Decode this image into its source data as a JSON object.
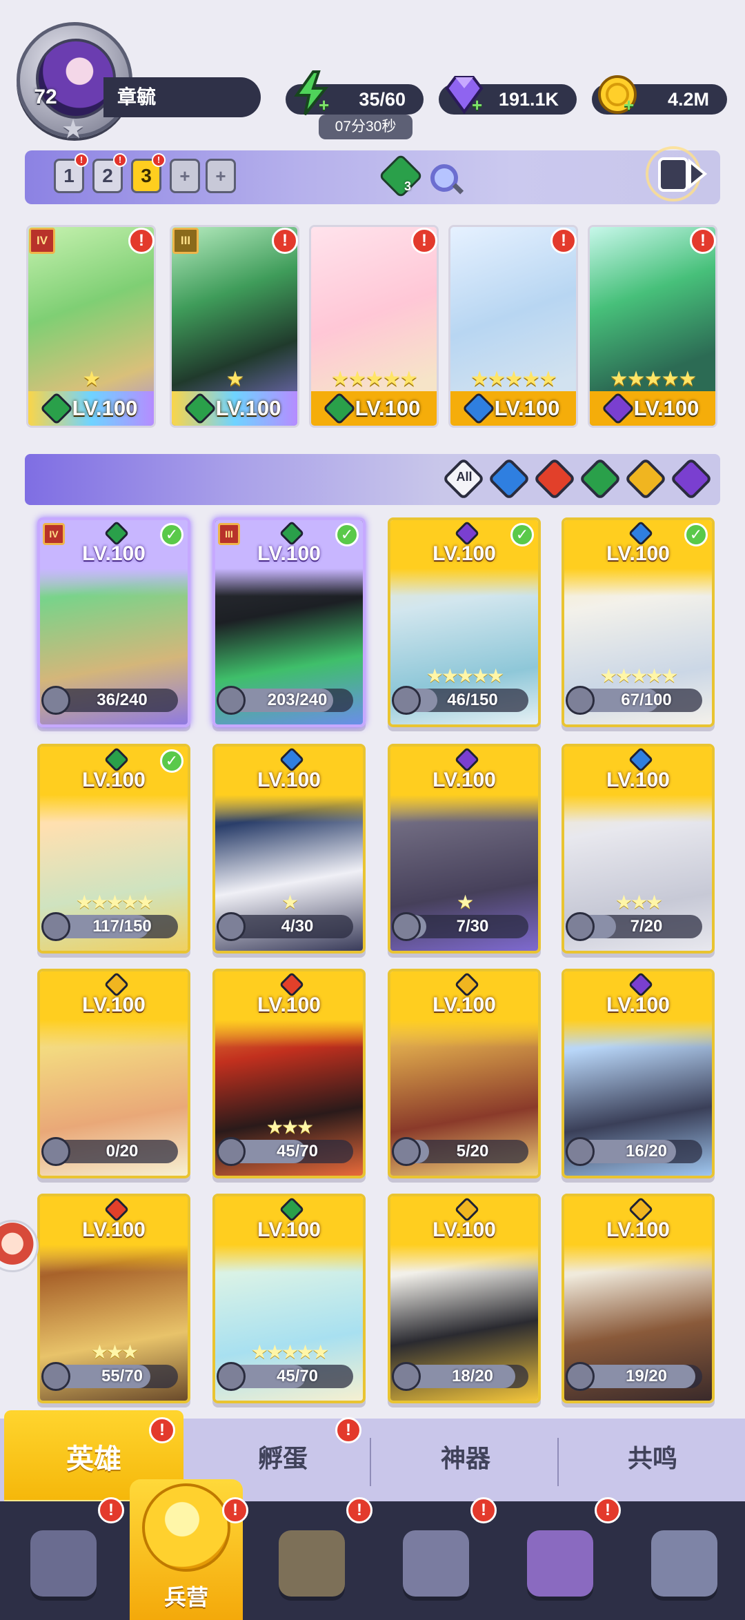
{
  "player": {
    "level": "72",
    "name": "章毓"
  },
  "resources": {
    "energy": "35/60",
    "energy_timer": "07分30秒",
    "gems": "191.1K",
    "gold": "4.2M"
  },
  "teams": {
    "slots": [
      "1",
      "2",
      "3"
    ],
    "active_slot": "3",
    "add_slots": [
      "+",
      "+"
    ],
    "gem_count": "3"
  },
  "lineup": [
    {
      "level": "LV.100",
      "element": "nature",
      "rank": "IV",
      "stars": "★",
      "alert": "!"
    },
    {
      "level": "LV.100",
      "element": "nature",
      "rank": "III",
      "stars": "★",
      "alert": "!"
    },
    {
      "level": "LV.100",
      "element": "nature",
      "rank": "",
      "stars": "★★★★★",
      "alert": "!"
    },
    {
      "level": "LV.100",
      "element": "water",
      "rank": "",
      "stars": "★★★★★",
      "alert": "!"
    },
    {
      "level": "LV.100",
      "element": "dark",
      "rank": "",
      "stars": "★★★★★",
      "alert": "!"
    }
  ],
  "filters": {
    "all_label": "All",
    "elements": [
      "water",
      "fire",
      "nature",
      "light",
      "dark"
    ]
  },
  "heroes": [
    {
      "level": "LV.100",
      "element": "nature",
      "rank": "IV",
      "fragments": "36/240",
      "progress": 0.15,
      "checked": true,
      "style": "purple"
    },
    {
      "level": "LV.100",
      "element": "nature",
      "rank": "III",
      "fragments": "203/240",
      "progress": 0.85,
      "checked": true,
      "style": "purple"
    },
    {
      "level": "LV.100",
      "element": "dark",
      "rank": "",
      "fragments": "46/150",
      "progress": 0.31,
      "checked": true,
      "style": "gold"
    },
    {
      "level": "LV.100",
      "element": "water",
      "rank": "",
      "fragments": "67/100",
      "progress": 0.67,
      "checked": true,
      "style": "gold"
    },
    {
      "level": "LV.100",
      "element": "nature",
      "rank": "",
      "fragments": "117/150",
      "progress": 0.78,
      "checked": true,
      "style": "gold"
    },
    {
      "level": "LV.100",
      "element": "water",
      "rank": "",
      "fragments": "4/30",
      "progress": 0.13,
      "checked": false,
      "style": "gold"
    },
    {
      "level": "LV.100",
      "element": "dark",
      "rank": "",
      "fragments": "7/30",
      "progress": 0.23,
      "checked": false,
      "style": "gold"
    },
    {
      "level": "LV.100",
      "element": "water",
      "rank": "",
      "fragments": "7/20",
      "progress": 0.35,
      "checked": false,
      "style": "gold"
    },
    {
      "level": "LV.100",
      "element": "light",
      "rank": "",
      "fragments": "0/20",
      "progress": 0.0,
      "checked": false,
      "style": "gold"
    },
    {
      "level": "LV.100",
      "element": "fire",
      "rank": "",
      "fragments": "45/70",
      "progress": 0.64,
      "checked": false,
      "style": "gold"
    },
    {
      "level": "LV.100",
      "element": "light",
      "rank": "",
      "fragments": "5/20",
      "progress": 0.25,
      "checked": false,
      "style": "gold"
    },
    {
      "level": "LV.100",
      "element": "dark",
      "rank": "",
      "fragments": "16/20",
      "progress": 0.8,
      "checked": false,
      "style": "gold"
    },
    {
      "level": "LV.100",
      "element": "fire",
      "rank": "",
      "fragments": "55/70",
      "progress": 0.79,
      "checked": false,
      "style": "gold"
    },
    {
      "level": "LV.100",
      "element": "nature",
      "rank": "",
      "fragments": "45/70",
      "progress": 0.64,
      "checked": false,
      "style": "gold"
    },
    {
      "level": "LV.100",
      "element": "light",
      "rank": "",
      "fragments": "18/20",
      "progress": 0.9,
      "checked": false,
      "style": "gold"
    },
    {
      "level": "LV.100",
      "element": "light",
      "rank": "",
      "fragments": "19/20",
      "progress": 0.95,
      "checked": false,
      "style": "gold"
    }
  ],
  "subtabs": [
    {
      "label": "英雄",
      "active": true,
      "alert": "!"
    },
    {
      "label": "孵蛋",
      "active": false,
      "alert": "!"
    },
    {
      "label": "神器",
      "active": false,
      "alert": ""
    },
    {
      "label": "共鸣",
      "active": false,
      "alert": ""
    }
  ],
  "bottom_nav": [
    {
      "icon": "cards-icon",
      "label": "",
      "alert": "!"
    },
    {
      "icon": "barracks-icon",
      "label": "兵营",
      "alert": "!",
      "active": true
    },
    {
      "icon": "map-icon",
      "label": "",
      "alert": "!"
    },
    {
      "icon": "castle-icon",
      "label": "",
      "alert": "!"
    },
    {
      "icon": "mushroom-icon",
      "label": "",
      "alert": "!"
    },
    {
      "icon": "guild-banner-icon",
      "label": "",
      "alert": ""
    }
  ],
  "colors": {
    "nature": "#2aa04a",
    "water": "#2f7fe0",
    "fire": "#e2402a",
    "light": "#f0b520",
    "dark": "#7a3fd0",
    "accent_gold": "#f5b70a",
    "panel": "#30334a"
  }
}
